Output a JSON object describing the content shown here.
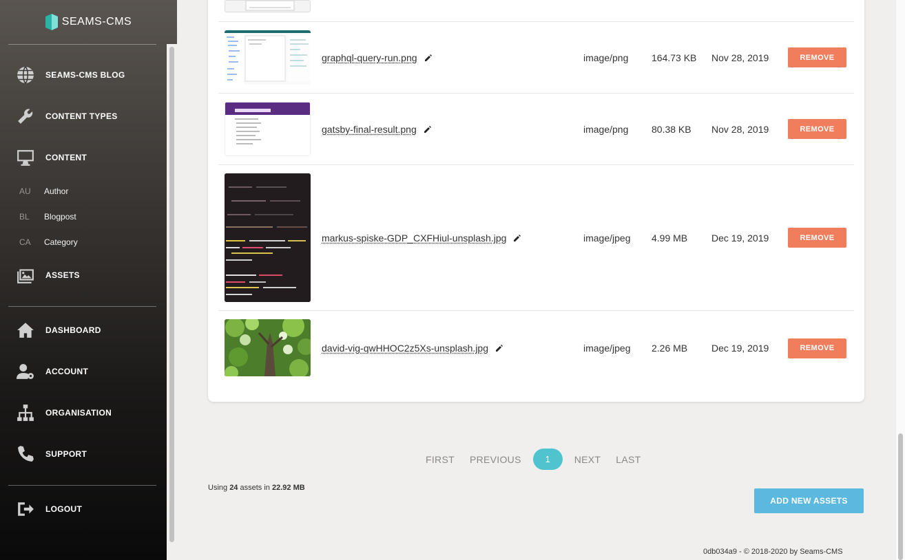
{
  "brand": {
    "name": "SEAMS-CMS"
  },
  "nav": {
    "blog": "SEAMS-CMS BLOG",
    "content_types": "CONTENT TYPES",
    "content": "CONTENT",
    "sub_items": [
      {
        "abbr": "AU",
        "label": "Author"
      },
      {
        "abbr": "BL",
        "label": "Blogpost"
      },
      {
        "abbr": "CA",
        "label": "Category"
      }
    ],
    "assets": "ASSETS",
    "dashboard": "DASHBOARD",
    "account": "ACCOUNT",
    "organisation": "ORGANISATION",
    "support": "SUPPORT",
    "logout": "LOGOUT"
  },
  "assets": [
    {
      "filename": "graphql-query-run.png",
      "mime": "image/png",
      "size": "164.73 KB",
      "date": "Nov 28, 2019",
      "remove": "REMOVE"
    },
    {
      "filename": "gatsby-final-result.png",
      "mime": "image/png",
      "size": "80.38 KB",
      "date": "Nov 28, 2019",
      "remove": "REMOVE"
    },
    {
      "filename": "markus-spiske-GDP_CXFHiul-unsplash.jpg",
      "mime": "image/jpeg",
      "size": "4.99 MB",
      "date": "Dec 19, 2019",
      "remove": "REMOVE"
    },
    {
      "filename": "david-vig-qwHHOC2z5Xs-unsplash.jpg",
      "mime": "image/jpeg",
      "size": "2.26 MB",
      "date": "Dec 19, 2019",
      "remove": "REMOVE"
    }
  ],
  "pagination": {
    "first": "FIRST",
    "previous": "PREVIOUS",
    "current": "1",
    "next": "NEXT",
    "last": "LAST"
  },
  "usage": {
    "prefix": "Using",
    "count": "24",
    "middle": "assets in",
    "total": "22.92 MB"
  },
  "add_button": "ADD NEW ASSETS",
  "footer": "0db034a9 - © 2018-2020 by Seams-CMS",
  "colors": {
    "remove": "#f07e5c",
    "accent": "#4fc4cf",
    "add": "#5bb8df"
  }
}
